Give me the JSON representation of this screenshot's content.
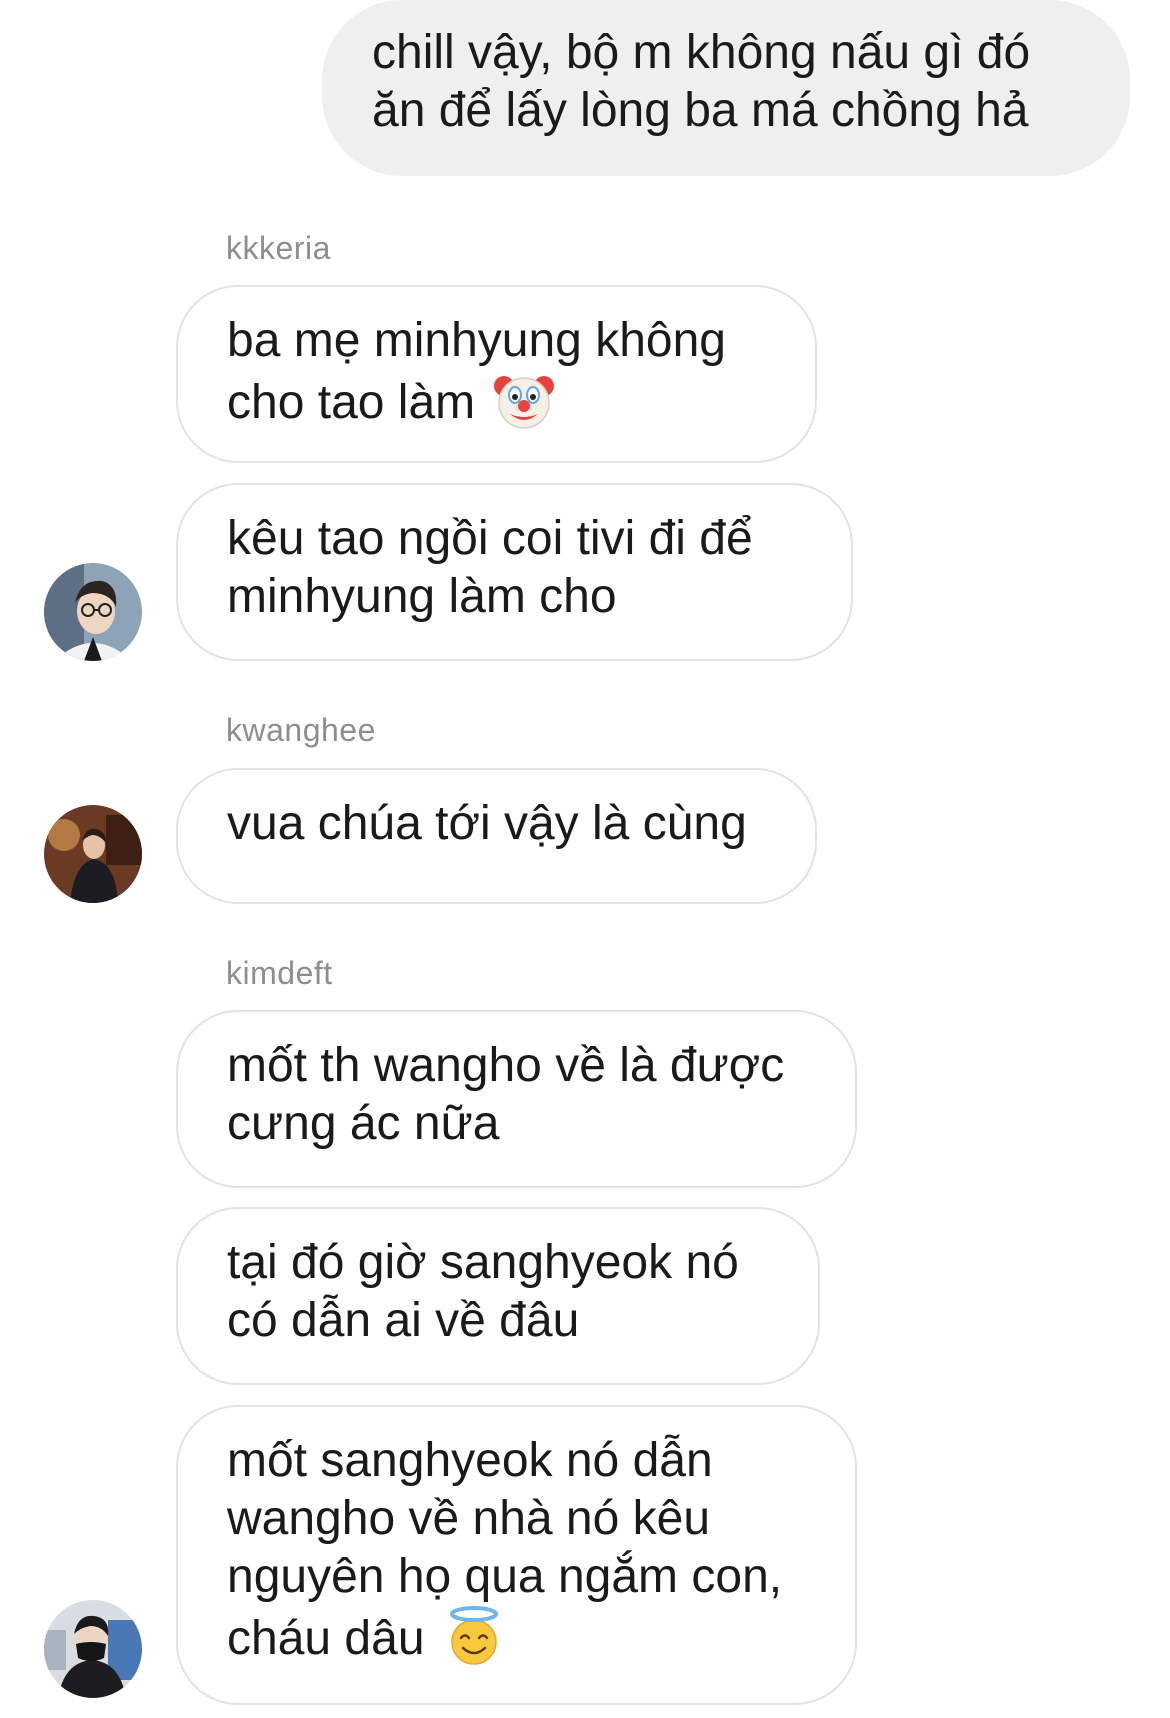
{
  "messages": [
    {
      "type": "sent",
      "text": "chill vậy, bộ m không nấu gì đó ăn để lấy lòng ba má chồng hả"
    },
    {
      "type": "received",
      "sender": "kkkeria",
      "text": "ba mẹ minhyung không cho tao làm",
      "emoji": "clown-face"
    },
    {
      "type": "received",
      "text": "kêu tao ngồi coi tivi đi để minhyung làm cho"
    },
    {
      "type": "received",
      "sender": "kwanghee",
      "text": "vua chúa tới vậy là cùng"
    },
    {
      "type": "received",
      "sender": "kimdeft",
      "text": "mốt th wangho về là được cưng ác nữa"
    },
    {
      "type": "received",
      "text": "tại đó giờ sanghyeok nó có dẫn ai về đâu"
    },
    {
      "type": "received",
      "text": "mốt sanghyeok nó dẫn wangho về nhà nó kêu nguyên họ qua ngắm con, cháu dâu",
      "emoji": "smiling-face-with-halo"
    }
  ],
  "colors": {
    "sent_bubble": "#efefef",
    "received_border": "#e3e3e3",
    "sender_name": "#8e8e8e",
    "text": "#1a1a1a"
  }
}
